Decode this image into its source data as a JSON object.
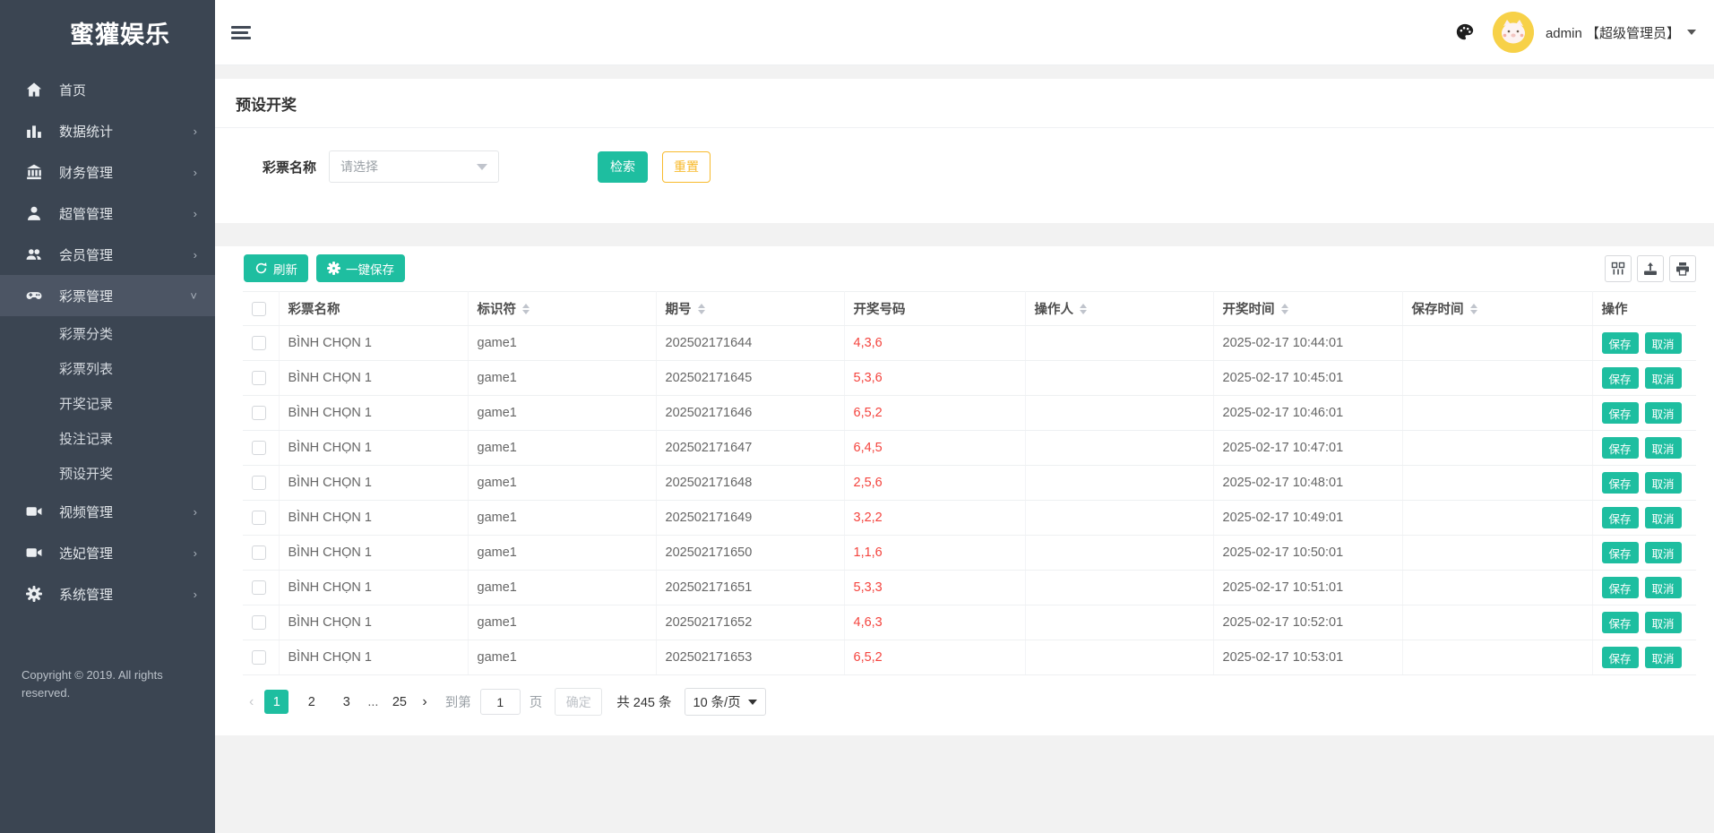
{
  "sidebar": {
    "logo": "蜜獾娱乐",
    "items": [
      {
        "label": "首页"
      },
      {
        "label": "数据统计"
      },
      {
        "label": "财务管理"
      },
      {
        "label": "超管管理"
      },
      {
        "label": "会员管理"
      },
      {
        "label": "彩票管理"
      },
      {
        "label": "视频管理"
      },
      {
        "label": "选妃管理"
      },
      {
        "label": "系统管理"
      }
    ],
    "submenu": [
      {
        "label": "彩票分类"
      },
      {
        "label": "彩票列表"
      },
      {
        "label": "开奖记录"
      },
      {
        "label": "投注记录"
      },
      {
        "label": "预设开奖"
      }
    ],
    "copyright": "Copyright © 2019. All rights reserved."
  },
  "header": {
    "user": "admin 【超级管理员】"
  },
  "page": {
    "title": "预设开奖"
  },
  "filter": {
    "label": "彩票名称",
    "select_placeholder": "请选择",
    "search_label": "检索",
    "reset_label": "重置"
  },
  "toolbar": {
    "refresh_label": "刷新",
    "save_all_label": "一键保存"
  },
  "table": {
    "headers": [
      "彩票名称",
      "标识符",
      "期号",
      "开奖号码",
      "操作人",
      "开奖时间",
      "保存时间",
      "操作"
    ],
    "save_label": "保存",
    "cancel_label": "取消",
    "rows": [
      {
        "name": "BÌNH CHỌN 1",
        "code": "game1",
        "issue": "202502171644",
        "numbers": "4,3,6",
        "operator": "",
        "draw_time": "2025-02-17 10:44:01",
        "save_time": ""
      },
      {
        "name": "BÌNH CHỌN 1",
        "code": "game1",
        "issue": "202502171645",
        "numbers": "5,3,6",
        "operator": "",
        "draw_time": "2025-02-17 10:45:01",
        "save_time": ""
      },
      {
        "name": "BÌNH CHỌN 1",
        "code": "game1",
        "issue": "202502171646",
        "numbers": "6,5,2",
        "operator": "",
        "draw_time": "2025-02-17 10:46:01",
        "save_time": ""
      },
      {
        "name": "BÌNH CHỌN 1",
        "code": "game1",
        "issue": "202502171647",
        "numbers": "6,4,5",
        "operator": "",
        "draw_time": "2025-02-17 10:47:01",
        "save_time": ""
      },
      {
        "name": "BÌNH CHỌN 1",
        "code": "game1",
        "issue": "202502171648",
        "numbers": "2,5,6",
        "operator": "",
        "draw_time": "2025-02-17 10:48:01",
        "save_time": ""
      },
      {
        "name": "BÌNH CHỌN 1",
        "code": "game1",
        "issue": "202502171649",
        "numbers": "3,2,2",
        "operator": "",
        "draw_time": "2025-02-17 10:49:01",
        "save_time": ""
      },
      {
        "name": "BÌNH CHỌN 1",
        "code": "game1",
        "issue": "202502171650",
        "numbers": "1,1,6",
        "operator": "",
        "draw_time": "2025-02-17 10:50:01",
        "save_time": ""
      },
      {
        "name": "BÌNH CHỌN 1",
        "code": "game1",
        "issue": "202502171651",
        "numbers": "5,3,3",
        "operator": "",
        "draw_time": "2025-02-17 10:51:01",
        "save_time": ""
      },
      {
        "name": "BÌNH CHỌN 1",
        "code": "game1",
        "issue": "202502171652",
        "numbers": "4,6,3",
        "operator": "",
        "draw_time": "2025-02-17 10:52:01",
        "save_time": ""
      },
      {
        "name": "BÌNH CHỌN 1",
        "code": "game1",
        "issue": "202502171653",
        "numbers": "6,5,2",
        "operator": "",
        "draw_time": "2025-02-17 10:53:01",
        "save_time": ""
      }
    ]
  },
  "pagination": {
    "pages": [
      "1",
      "2",
      "3",
      "...",
      "25"
    ],
    "goto_label": "到第",
    "goto_value": "1",
    "page_unit": "页",
    "confirm_label": "确定",
    "total_label": "共 245 条",
    "per_page_label": "10 条/页"
  },
  "colors": {
    "accent": "#1ebea0",
    "warning": "#f8ba2c",
    "danger": "#f4443e",
    "sidebar": "#3b4552"
  }
}
